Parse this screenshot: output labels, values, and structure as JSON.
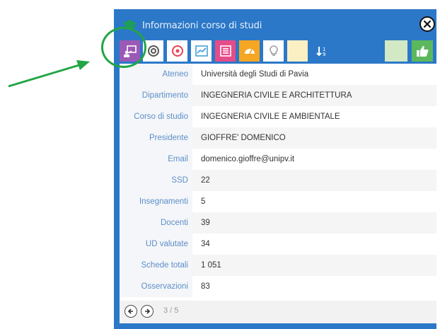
{
  "popup": {
    "title": "Informazioni corso di studi",
    "accent": "#2c78c8"
  },
  "tabs": [
    {
      "name": "tab-info",
      "icon": "presenter-icon",
      "color": "#9b59b6"
    },
    {
      "name": "tab-target",
      "icon": "target-icon",
      "color": "#3a7fc4"
    },
    {
      "name": "tab-bullseye",
      "icon": "bullseye-icon",
      "color": "#e8445a"
    },
    {
      "name": "tab-chart",
      "icon": "line-chart-icon",
      "color": "#3a9ad9"
    },
    {
      "name": "tab-list",
      "icon": "list-icon",
      "color": "#e64c8a"
    },
    {
      "name": "tab-gauge",
      "icon": "gauge-icon",
      "color": "#f5a623"
    },
    {
      "name": "tab-lightbulb",
      "icon": "lightbulb-icon",
      "color": "#f3e47a"
    },
    {
      "name": "tab-empty",
      "icon": "blank-icon",
      "color": "#fbefc4"
    },
    {
      "name": "tab-sort",
      "icon": "sort-icon",
      "color": "#2c78c8"
    },
    {
      "name": "tab-empty-2",
      "icon": "blank-icon",
      "color": "#c6e5b3"
    },
    {
      "name": "tab-thumbs-up",
      "icon": "thumbs-up-icon",
      "color": "#5cb85c"
    }
  ],
  "details": [
    {
      "label": "Ateneo",
      "value": "Università degli Studi di Pavia"
    },
    {
      "label": "Dipartimento",
      "value": "INGEGNERIA CIVILE E ARCHITETTURA"
    },
    {
      "label": "Corso di studio",
      "value": "INGEGNERIA CIVILE E AMBIENTALE"
    },
    {
      "label": "Presidente",
      "value": "GIOFFRE' DOMENICO"
    },
    {
      "label": "Email",
      "value": "domenico.gioffre@unipv.it"
    },
    {
      "label": "SSD",
      "value": "22"
    },
    {
      "label": "Insegnamenti",
      "value": "5"
    },
    {
      "label": "Docenti",
      "value": "39"
    },
    {
      "label": "UD valutate",
      "value": "34"
    },
    {
      "label": "Schede totali",
      "value": "1 051"
    },
    {
      "label": "Osservazioni",
      "value": "83"
    }
  ],
  "footer": {
    "pager": "3 / 5"
  },
  "annotation": {
    "color": "#22a545"
  }
}
